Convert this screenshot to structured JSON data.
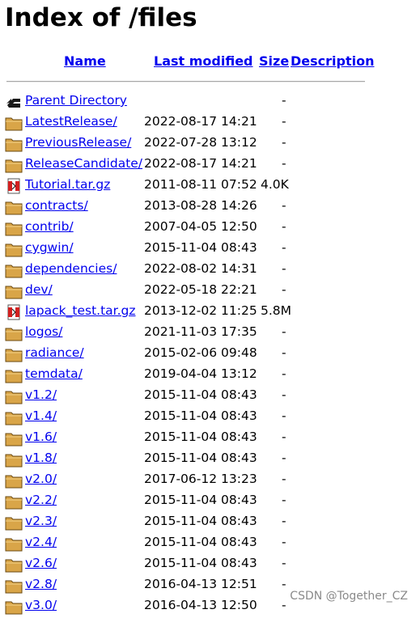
{
  "page": {
    "title": "Index of /files"
  },
  "columns": {
    "name": "Name",
    "last_modified": "Last modified",
    "size": "Size",
    "description": "Description"
  },
  "rows": [
    {
      "icon": "back-icon",
      "name": "Parent Directory",
      "date": "",
      "size": "-"
    },
    {
      "icon": "folder-icon",
      "name": "LatestRelease/",
      "date": "2022-08-17 14:21",
      "size": "-"
    },
    {
      "icon": "folder-icon",
      "name": "PreviousRelease/",
      "date": "2022-07-28 13:12",
      "size": "-"
    },
    {
      "icon": "folder-icon",
      "name": "ReleaseCandidate/",
      "date": "2022-08-17 14:21",
      "size": "-"
    },
    {
      "icon": "compressed-file-icon",
      "name": "Tutorial.tar.gz",
      "date": "2011-08-11 07:52",
      "size": "4.0K"
    },
    {
      "icon": "folder-icon",
      "name": "contracts/",
      "date": "2013-08-28 14:26",
      "size": "-"
    },
    {
      "icon": "folder-icon",
      "name": "contrib/",
      "date": "2007-04-05 12:50",
      "size": "-"
    },
    {
      "icon": "folder-icon",
      "name": "cygwin/",
      "date": "2015-11-04 08:43",
      "size": "-"
    },
    {
      "icon": "folder-icon",
      "name": "dependencies/",
      "date": "2022-08-02 14:31",
      "size": "-"
    },
    {
      "icon": "folder-icon",
      "name": "dev/",
      "date": "2022-05-18 22:21",
      "size": "-"
    },
    {
      "icon": "compressed-file-icon",
      "name": "lapack_test.tar.gz",
      "date": "2013-12-02 11:25",
      "size": "5.8M"
    },
    {
      "icon": "folder-icon",
      "name": "logos/",
      "date": "2021-11-03 17:35",
      "size": "-"
    },
    {
      "icon": "folder-icon",
      "name": "radiance/",
      "date": "2015-02-06 09:48",
      "size": "-"
    },
    {
      "icon": "folder-icon",
      "name": "temdata/",
      "date": "2019-04-04 13:12",
      "size": "-"
    },
    {
      "icon": "folder-icon",
      "name": "v1.2/",
      "date": "2015-11-04 08:43",
      "size": "-"
    },
    {
      "icon": "folder-icon",
      "name": "v1.4/",
      "date": "2015-11-04 08:43",
      "size": "-"
    },
    {
      "icon": "folder-icon",
      "name": "v1.6/",
      "date": "2015-11-04 08:43",
      "size": "-"
    },
    {
      "icon": "folder-icon",
      "name": "v1.8/",
      "date": "2015-11-04 08:43",
      "size": "-"
    },
    {
      "icon": "folder-icon",
      "name": "v2.0/",
      "date": "2017-06-12 13:23",
      "size": "-"
    },
    {
      "icon": "folder-icon",
      "name": "v2.2/",
      "date": "2015-11-04 08:43",
      "size": "-"
    },
    {
      "icon": "folder-icon",
      "name": "v2.3/",
      "date": "2015-11-04 08:43",
      "size": "-"
    },
    {
      "icon": "folder-icon",
      "name": "v2.4/",
      "date": "2015-11-04 08:43",
      "size": "-"
    },
    {
      "icon": "folder-icon",
      "name": "v2.6/",
      "date": "2015-11-04 08:43",
      "size": "-"
    },
    {
      "icon": "folder-icon",
      "name": "v2.8/",
      "date": "2016-04-13 12:51",
      "size": "-"
    },
    {
      "icon": "folder-icon",
      "name": "v3.0/",
      "date": "2016-04-13 12:50",
      "size": "-"
    }
  ],
  "watermark": "CSDN @Together_CZ",
  "colors": {
    "link": "#0000ee",
    "folder": "#d9a548",
    "rule": "#a8a8a8"
  }
}
